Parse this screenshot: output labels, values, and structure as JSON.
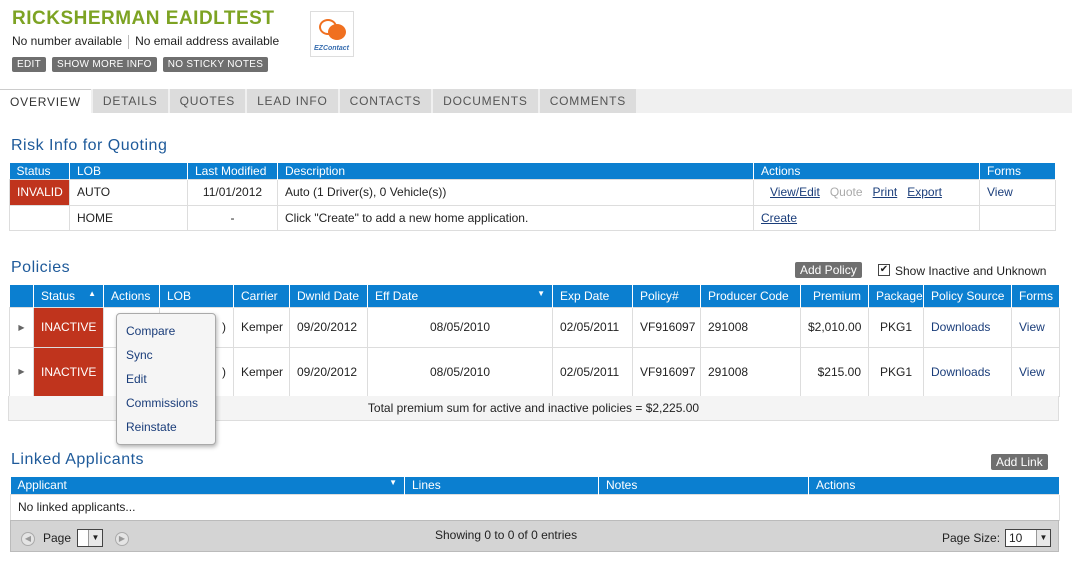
{
  "header": {
    "client_name": "RICKSHERMAN EAIDLTEST",
    "phone": "No number available",
    "email": "No email address available",
    "buttons": [
      "EDIT",
      "SHOW MORE INFO",
      "NO STICKY NOTES"
    ],
    "logo_text": "EZContact"
  },
  "tabs": [
    "OVERVIEW",
    "DETAILS",
    "QUOTES",
    "LEAD INFO",
    "CONTACTS",
    "DOCUMENTS",
    "COMMENTS"
  ],
  "risk": {
    "title": "Risk Info for Quoting",
    "columns": [
      "Status",
      "LOB",
      "Last Modified",
      "Description",
      "Actions",
      "Forms"
    ],
    "rows": [
      {
        "status": "INVALID",
        "lob": "AUTO",
        "modified": "11/01/2012",
        "description": "Auto (1 Driver(s), 0 Vehicle(s))",
        "actions": [
          "View/Edit",
          "Quote",
          "Print",
          "Export"
        ],
        "forms": "View"
      },
      {
        "status": "",
        "lob": "HOME",
        "modified": "-",
        "description": "Click \"Create\" to add a new home application.",
        "actions": [
          "Create"
        ],
        "forms": ""
      }
    ]
  },
  "policies": {
    "title": "Policies",
    "add_label": "Add Policy",
    "show_inactive_label": "Show Inactive and Unknown",
    "show_inactive_checked": "✔",
    "columns": [
      "Status",
      "Actions",
      "LOB",
      "Carrier",
      "Dwnld Date",
      "Eff Date",
      "Exp Date",
      "Policy#",
      "Producer Code",
      "Premium",
      "Package",
      "Policy Source",
      "Forms"
    ],
    "rows": [
      {
        "status": "INACTIVE",
        "lob": ")",
        "carrier": "Kemper",
        "dwnld": "09/20/2012",
        "eff": "08/05/2010",
        "exp": "02/05/2011",
        "policy": "VF916097",
        "producer": "291008",
        "premium": "$2,010.00",
        "package": "PKG1",
        "source": "Downloads",
        "forms": "View"
      },
      {
        "status": "INACTIVE",
        "lob": ")",
        "carrier": "Kemper",
        "dwnld": "09/20/2012",
        "eff": "08/05/2010",
        "exp": "02/05/2011",
        "policy": "VF916097",
        "producer": "291008",
        "premium": "$215.00",
        "package": "PKG1",
        "source": "Downloads",
        "forms": "View"
      }
    ],
    "total": "Total premium sum for active and inactive policies = $2,225.00",
    "actions_menu": [
      "Compare",
      "Sync",
      "Edit",
      "Commissions",
      "Reinstate"
    ]
  },
  "linked": {
    "title": "Linked Applicants",
    "add_label": "Add Link",
    "columns": [
      "Applicant",
      "Lines",
      "Notes",
      "Actions"
    ],
    "empty": "No linked applicants...",
    "pager": {
      "page_label": "Page",
      "showing": "Showing 0 to 0 of 0 entries",
      "page_size_label": "Page Size:",
      "page_size": "10"
    }
  }
}
